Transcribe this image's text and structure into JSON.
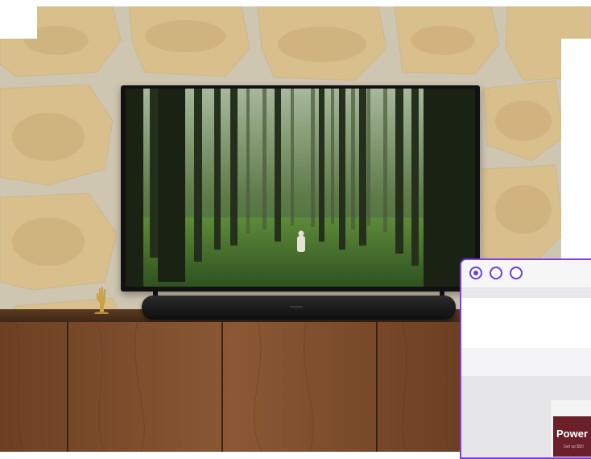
{
  "scene": {
    "description_colors": {
      "wall": "#d9c49a",
      "mortar": "#cfc6b2",
      "wood": "#7a4a2b",
      "accent": "#6a3ce6",
      "promo_bg": "#6a1f2a"
    }
  },
  "window": {
    "controls": [
      "radio-selected",
      "radio",
      "radio"
    ],
    "promo": {
      "title": "Power u",
      "subtitle": "Get up $50"
    }
  }
}
